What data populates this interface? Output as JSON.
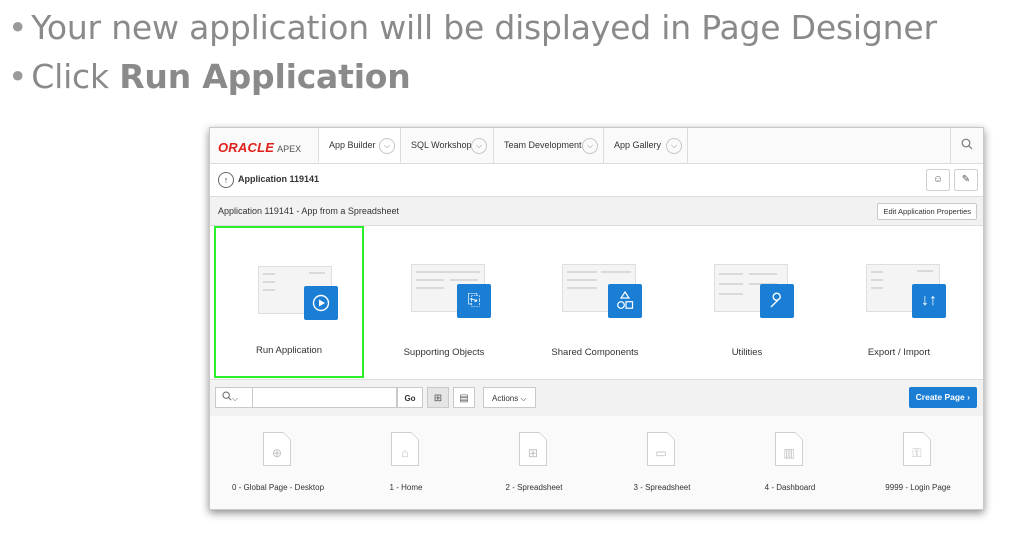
{
  "slide": {
    "bullet1": "Your new application will be displayed in Page Designer",
    "bullet2_prefix": "Click ",
    "bullet2_bold": "Run Application"
  },
  "apex": {
    "logo": {
      "oracle": "ORACLE",
      "apex": "APEX"
    },
    "nav_tabs": [
      "App Builder",
      "SQL Workshop",
      "Team Development",
      "App Gallery"
    ],
    "breadcrumb": "Application 119141",
    "app_title": "Application 119141 - App from a Spreadsheet",
    "edit_props_label": "Edit Application Properties",
    "tiles": [
      {
        "label": "Run Application",
        "icon": "play-icon"
      },
      {
        "label": "Supporting Objects",
        "icon": "scroll-icon"
      },
      {
        "label": "Shared Components",
        "icon": "shapes-icon"
      },
      {
        "label": "Utilities",
        "icon": "wrench-icon"
      },
      {
        "label": "Export / Import",
        "icon": "arrows-updown-icon"
      }
    ],
    "toolbar": {
      "go_label": "Go",
      "actions_label": "Actions",
      "create_page_label": "Create Page"
    },
    "pages": [
      {
        "label": "0 - Global Page - Desktop",
        "icon": "globe-icon"
      },
      {
        "label": "1 - Home",
        "icon": "home-icon"
      },
      {
        "label": "2 - Spreadsheet",
        "icon": "grid-icon"
      },
      {
        "label": "3 - Spreadsheet",
        "icon": "form-icon"
      },
      {
        "label": "4 - Dashboard",
        "icon": "bar-chart-icon"
      },
      {
        "label": "9999 - Login Page",
        "icon": "lock-icon"
      }
    ],
    "colors": {
      "accent": "#1a7fd4",
      "selection": "#2cf02c",
      "oracle_red": "#e0201b"
    }
  }
}
